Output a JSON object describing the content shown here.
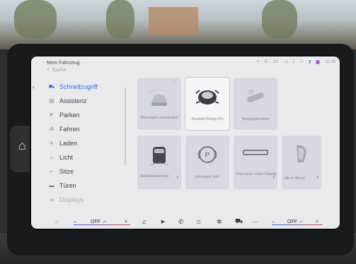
{
  "header": {
    "title": "Mein Fahrzeug",
    "search_placeholder": "Suche",
    "time": "11:09",
    "temp": "10°"
  },
  "sidebar": {
    "items": [
      {
        "label": "Schnellzugriff",
        "icon": "car-icon",
        "active": true
      },
      {
        "label": "Assistenz",
        "icon": "assist-icon"
      },
      {
        "label": "Parken",
        "icon": "parking-icon"
      },
      {
        "label": "Fahren",
        "icon": "driving-icon"
      },
      {
        "label": "Laden",
        "icon": "charging-icon"
      },
      {
        "label": "Licht",
        "icon": "light-icon"
      },
      {
        "label": "Sitze",
        "icon": "seat-icon"
      },
      {
        "label": "Türen",
        "icon": "door-icon"
      },
      {
        "label": "Displays",
        "icon": "display-icon"
      }
    ]
  },
  "tiles": [
    {
      "label": "Warnungen ausschalten",
      "icon": "warning-car-icon"
    },
    {
      "label": "Assisted Driving Pro",
      "icon": "assisted-driving-icon",
      "selected": true
    },
    {
      "label": "Neigungsfunktion",
      "icon": "tilt-icon"
    },
    {
      "label": "Stabilitätskontrolle",
      "icon": "stability-car-icon",
      "chevron": true
    },
    {
      "label": "Automatic Hold",
      "icon": "auto-hold-icon"
    },
    {
      "label": "Panoramic Vision Display",
      "icon": "panoramic-display-icon",
      "chevron": true
    },
    {
      "label": "Mirror Wheel",
      "icon": "mirror-icon",
      "chevron": true
    }
  ],
  "bottombar": {
    "left_off": "OFF",
    "right_off": "OFF",
    "minus_left": "–",
    "plus_left": "+",
    "minus_right": "–",
    "plus_right": "+"
  },
  "colors": {
    "accent": "#2f6fe0",
    "status_dot": "#b054c9"
  }
}
